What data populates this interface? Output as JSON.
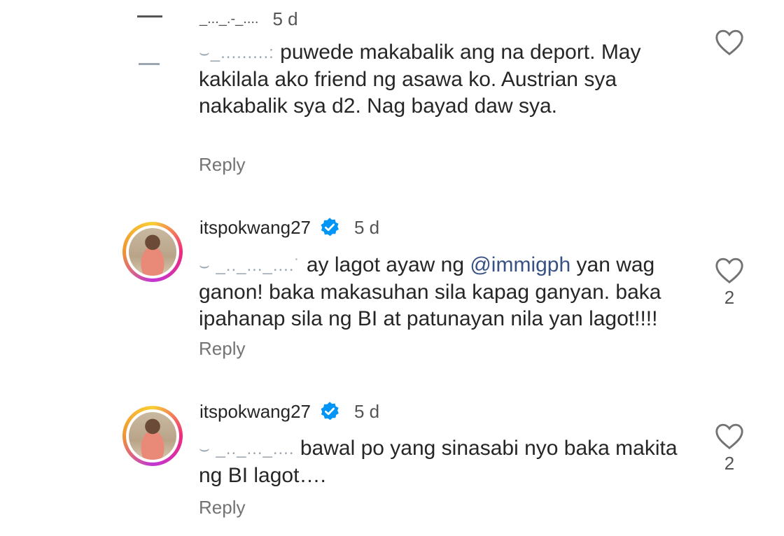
{
  "comments": [
    {
      "username_redacted": "_..._.-_....",
      "age": "5 d",
      "mention_redacted": "⌣_.........:",
      "text": "puwede makabalik ang na deport. May kakilala ako friend ng asawa ko. Austrian sya nakabalik sya d2. Nag bayad daw sya.",
      "reply_label": "Reply",
      "likes": ""
    },
    {
      "username": "itspokwang27",
      "age": "5 d",
      "mention_redacted": "⌣ _.._..._....˙",
      "text_before": "ay lagot ayaw ng ",
      "mention": "@immigph",
      "text_after": " yan wag ganon! baka makasuhan sila kapag ganyan. baka ipahanap sila ng BI at patunayan nila yan lagot!!!!",
      "reply_label": "Reply",
      "likes": "2"
    },
    {
      "username": "itspokwang27",
      "age": "5 d",
      "mention_redacted": "⌣ _.._..._....",
      "text": "bawal po yang sinasabi nyo baka makita ng BI lagot….",
      "reply_label": "Reply",
      "likes": "2"
    }
  ],
  "colors": {
    "verified": "#0095f6",
    "mention": "#385185",
    "muted": "#737373"
  },
  "icons": {
    "like": "heart-outline-icon",
    "verified": "verified-badge-icon"
  }
}
